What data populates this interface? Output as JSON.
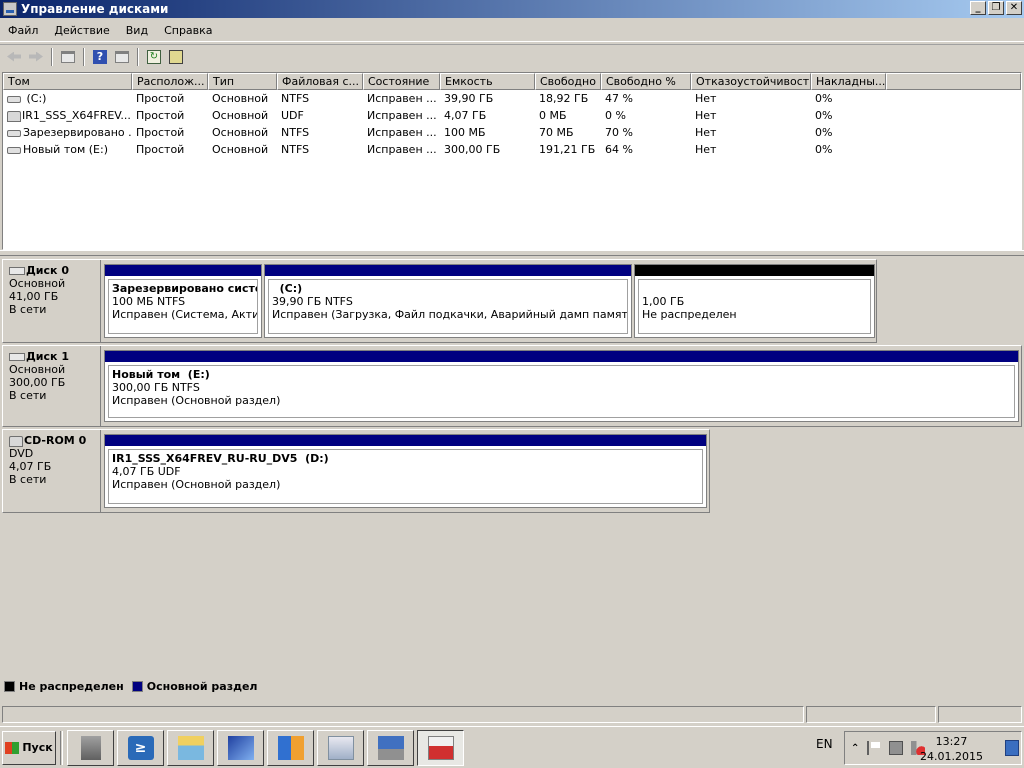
{
  "window": {
    "title": "Управление дисками",
    "buttons": {
      "minimize": "_",
      "maximize": "❐",
      "close": "✕"
    }
  },
  "menu": [
    "Файл",
    "Действие",
    "Вид",
    "Справка"
  ],
  "toolbar": [
    "back-icon",
    "forward-icon",
    "show-hide-pane-icon",
    "help-icon",
    "pane-icon",
    "refresh-icon",
    "properties-icon"
  ],
  "volumes": {
    "columns": [
      "Том",
      "Располож...",
      "Тип",
      "Файловая с...",
      "Состояние",
      "Емкость",
      "Свободно",
      "Свободно %",
      "Отказоустойчивость",
      "Накладны..."
    ],
    "rows": [
      {
        "icon": "drive",
        "name": " (C:)",
        "layout": "Простой",
        "type": "Основной",
        "fs": "NTFS",
        "status": "Исправен ...",
        "capacity": "39,90 ГБ",
        "free": "18,92 ГБ",
        "free_pct": "47 %",
        "fault": "Нет",
        "overhead": "0%"
      },
      {
        "icon": "cdrom",
        "name": "IR1_SSS_X64FREV...",
        "layout": "Простой",
        "type": "Основной",
        "fs": "UDF",
        "status": "Исправен ...",
        "capacity": "4,07 ГБ",
        "free": "0 МБ",
        "free_pct": "0 %",
        "fault": "Нет",
        "overhead": "0%"
      },
      {
        "icon": "drive",
        "name": "Зарезервировано ...",
        "layout": "Простой",
        "type": "Основной",
        "fs": "NTFS",
        "status": "Исправен ...",
        "capacity": "100 МБ",
        "free": "70 МБ",
        "free_pct": "70 %",
        "fault": "Нет",
        "overhead": "0%"
      },
      {
        "icon": "drive",
        "name": "Новый том (E:)",
        "layout": "Простой",
        "type": "Основной",
        "fs": "NTFS",
        "status": "Исправен ...",
        "capacity": "300,00 ГБ",
        "free": "191,21 ГБ",
        "free_pct": "64 %",
        "fault": "Нет",
        "overhead": "0%"
      }
    ]
  },
  "disks": [
    {
      "name": "Диск 0",
      "kind": "Основной",
      "size": "41,00 ГБ",
      "state": "В сети",
      "partitions": [
        {
          "title": "Зарезервировано систем",
          "size": "100 МБ NTFS",
          "status": "Исправен (Система, Активен",
          "color": "#000080"
        },
        {
          "title": "  (C:)",
          "size": "39,90 ГБ NTFS",
          "status": "Исправен (Загрузка, Файл подкачки, Аварийный дамп памяти, Осно",
          "color": "#000080"
        },
        {
          "title": "",
          "size": "1,00 ГБ",
          "status": "Не распределен",
          "color": "#000000"
        }
      ]
    },
    {
      "name": "Диск 1",
      "kind": "Основной",
      "size": "300,00 ГБ",
      "state": "В сети",
      "partitions": [
        {
          "title": "Новый том  (E:)",
          "size": "300,00 ГБ NTFS",
          "status": "Исправен (Основной раздел)",
          "color": "#000080"
        }
      ]
    },
    {
      "name": "CD-ROM 0",
      "kind": "DVD",
      "size": "4,07 ГБ",
      "state": "В сети",
      "partitions": [
        {
          "title": "IR1_SSS_X64FREV_RU-RU_DV5  (D:)",
          "size": "4,07 ГБ UDF",
          "status": "Исправен (Основной раздел)",
          "color": "#000080"
        }
      ]
    }
  ],
  "legend": [
    {
      "label": "Не распределен",
      "color": "#000000"
    },
    {
      "label": "Основной раздел",
      "color": "#000080"
    }
  ],
  "taskbar": {
    "start_label": "Пуск",
    "apps": [
      "server-manager-icon",
      "powershell-icon",
      "explorer-icon",
      "remote-desktop-icon",
      "windows-update-icon",
      "network-icon",
      "computer-management-icon",
      "disk-management-icon"
    ],
    "lang": "EN",
    "time": "13:27",
    "date": "24.01.2015"
  }
}
